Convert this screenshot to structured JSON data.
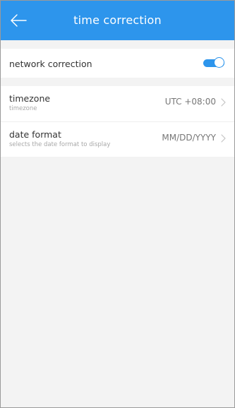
{
  "header": {
    "title": "time correction",
    "back_icon": "arrow-left-icon"
  },
  "settings": {
    "network_correction": {
      "label": "network correction",
      "enabled": true
    },
    "timezone": {
      "label": "timezone",
      "sublabel": "timezone",
      "value": "UTC +08:00"
    },
    "date_format": {
      "label": "date format",
      "sublabel": "selects the date format to display",
      "value": "MM/DD/YYYY"
    }
  },
  "colors": {
    "accent": "#2d95ec",
    "background": "#f3f3f3"
  }
}
